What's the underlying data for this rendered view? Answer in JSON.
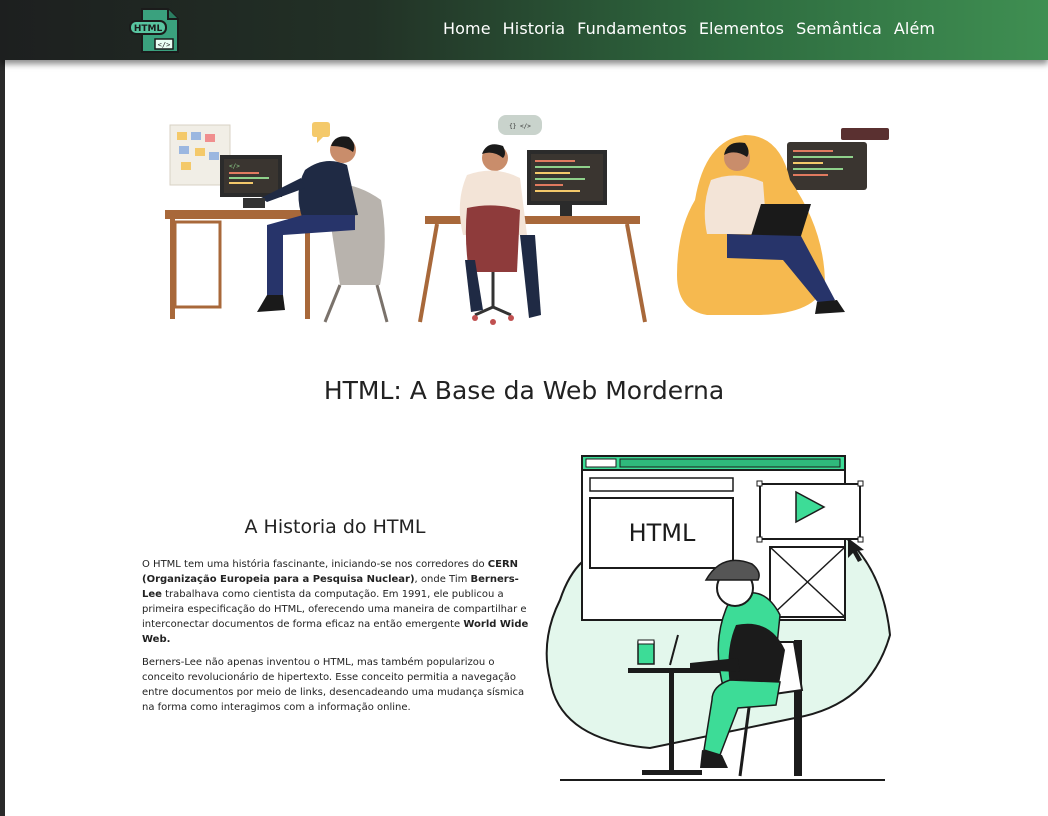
{
  "nav": {
    "logo_text": "HTML",
    "logo_tag": "</>",
    "items": [
      "Home",
      "Historia",
      "Fundamentos",
      "Elementos",
      "Semântica",
      "Além"
    ]
  },
  "hero": {
    "bubble1_code": "</>",
    "bubble2_code": "{} </>",
    "screen1_code": "</>"
  },
  "main_title": "HTML: A Base da Web Morderna",
  "history": {
    "title": "A Historia do HTML",
    "p1": {
      "t1": "O HTML tem uma história fascinante, iniciando-se nos corredores do ",
      "b1": "CERN (Organização Europeia para a Pesquisa Nuclear)",
      "t2": ", onde Tim ",
      "b2": "Berners-Lee",
      "t3": " trabalhava como cientista da computação. Em 1991, ele publicou a primeira especificação do HTML, oferecendo uma maneira de compartilhar e interconectar documentos de forma eficaz na então emergente ",
      "b3": "World Wide Web."
    },
    "p2": "Berners-Lee não apenas inventou o HTML, mas também popularizou o conceito revolucionário de hipertexto. Esse conceito permitia a navegação entre documentos por meio de links, desencadeando uma mudança sísmica na forma como interagimos com a informação online."
  },
  "illustration": {
    "screen_text": "HTML"
  },
  "colors": {
    "accent": "#3ddc97",
    "mint": "#e3f7ec",
    "nav_end": "#3f8f52"
  }
}
